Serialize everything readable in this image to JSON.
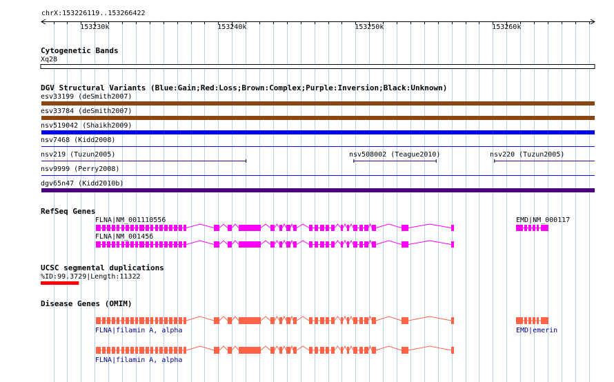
{
  "region": {
    "label": "chrX:153226119..153266422",
    "start": 153226119,
    "end": 153266422
  },
  "ruler": {
    "ticks": [
      {
        "pos": 153230000,
        "label": "153230k"
      },
      {
        "pos": 153240000,
        "label": "153240k"
      },
      {
        "pos": 153250000,
        "label": "153250k"
      },
      {
        "pos": 153260000,
        "label": "153260k"
      }
    ]
  },
  "colors": {
    "grid": "#b8d4ec",
    "gain": "#0000ff",
    "loss": "#ff0000",
    "complex": "#8b4513",
    "inversion": "#4b0082",
    "unknown": "#000000",
    "refseq": "#ff00ff",
    "segdup": "#ff0000",
    "omim": "#ff6347",
    "omim_label": "#000080"
  },
  "tracks": {
    "cytobands": {
      "title": "Cytogenetic Bands",
      "band_label": "Xq28"
    },
    "dgv": {
      "title": "DGV Structural Variants (Blue:Gain;Red:Loss;Brown:Complex;Purple:Inversion;Black:Unknown)",
      "rows": [
        {
          "label": "esv33199 (deSmith2007)",
          "type": "complex",
          "style": "thick",
          "start": 153224000,
          "end": 153268000
        },
        {
          "label": "esv33784 (deSmith2007)",
          "type": "complex",
          "style": "thick",
          "start": 153224000,
          "end": 153268000
        },
        {
          "label": "nsv519042 (Shaikh2009)",
          "type": "gain",
          "style": "thick",
          "start": 153224000,
          "end": 153268000
        },
        {
          "label": "nsv7468 (Kidd2008)",
          "type": "gain",
          "style": "thin",
          "start": 153224000,
          "end": 153268000
        },
        {
          "label": "nsv219 (Tuzun2005)",
          "type": "inversion",
          "style": "thin",
          "start": 153224000,
          "end": 153241050,
          "extra": [
            {
              "label": "nsv508002 (Teague2010)",
              "start": 153248850,
              "end": 153254900
            },
            {
              "label": "nsv220 (Tuzun2005)",
              "start": 153259100,
              "end": 153268000
            }
          ]
        },
        {
          "label": "nsv9999 (Perry2008)",
          "type": "gain",
          "style": "thin",
          "start": 153224000,
          "end": 153268000
        },
        {
          "label": "dgv65n47 (Kidd2010b)",
          "type": "inversion",
          "style": "thick",
          "start": 153224000,
          "end": 153268000
        }
      ]
    },
    "refseq": {
      "title": "RefSeq Genes",
      "genes": [
        {
          "label": "FLNA|NM_001110556",
          "start": 153230050,
          "end": 153256200,
          "label_pos": "above"
        },
        {
          "label": "FLNA|NM_001456",
          "start": 153230050,
          "end": 153256200,
          "label_pos": "above"
        },
        {
          "label": "EMD|NM_000117",
          "start": 153261100,
          "end": 153263400,
          "label_pos": "above"
        }
      ]
    },
    "segdup": {
      "title": "UCSC segmental duplications",
      "label": "%ID:99.3729|Length:11322",
      "start": 153226119,
      "end": 153228850
    },
    "omim": {
      "title": "Disease Genes (OMIM)",
      "genes": [
        {
          "label": "FLNA|filamin A, alpha",
          "start": 153230050,
          "end": 153256200
        },
        {
          "label": "EMD|emerin",
          "start": 153261100,
          "end": 153263400
        },
        {
          "label": "FLNA|filamin A, alpha",
          "start": 153230050,
          "end": 153256200
        }
      ]
    }
  }
}
